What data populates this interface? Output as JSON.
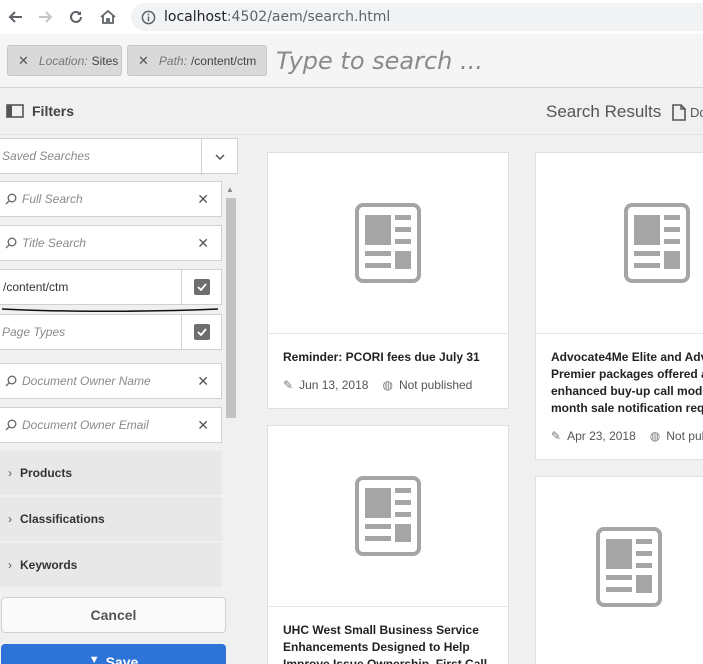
{
  "browser": {
    "url_host": "localhost",
    "url_rest": ":4502/aem/search.html"
  },
  "omnisearch": {
    "tags": [
      {
        "key": "Location:",
        "value": "Sites"
      },
      {
        "key": "Path:",
        "value": "/content/ctm"
      }
    ],
    "placeholder": "Type to search ..."
  },
  "rail_header": {
    "filters_label": "Filters",
    "results_label": "Search Results",
    "do_label": "Do"
  },
  "filters": {
    "saved_searches": "Saved Searches",
    "full_search": "Full Search",
    "title_search": "Title Search",
    "path_value": "/content/ctm",
    "page_types": "Page Types",
    "doc_owner_name": "Document Owner Name",
    "doc_owner_email": "Document Owner Email",
    "sections": [
      "Products",
      "Classifications",
      "Keywords"
    ],
    "cancel_label": "Cancel",
    "save_label": "Save"
  },
  "results": [
    {
      "title_lines": [
        "Reminder: PCORI fees due July 31"
      ],
      "date": "Jun 13, 2018",
      "status": "Not published"
    },
    {
      "title_lines": [
        "Advocate4Me Elite and Adv",
        "Premier packages offered as",
        "enhanced buy-up call mode",
        "month sale notification requ"
      ],
      "date": "Apr 23, 2018",
      "status": "Not publ"
    },
    {
      "title_lines": [
        "UHC West Small Business Service",
        "Enhancements Designed to Help",
        "Improve Issue Ownership, First Call"
      ],
      "date": "",
      "status": ""
    }
  ],
  "colors": {
    "accent": "#2d73d8",
    "placeholder_icon": "#a5a5a5"
  }
}
